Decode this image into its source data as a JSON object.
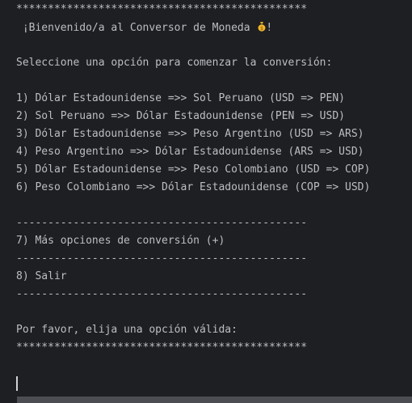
{
  "console": {
    "border_top": "**********************************************",
    "welcome": " ¡Bienvenido/a al Conversor de Moneda ",
    "welcome_icon": "money-bag-icon",
    "welcome_end": "!",
    "prompt_select": "Seleccione una opción para comenzar la conversión:",
    "options": [
      "1) Dólar Estadounidense =>> Sol Peruano (USD => PEN)",
      "2) Sol Peruano =>> Dólar Estadounidense (PEN => USD)",
      "3) Dólar Estadounidense =>> Peso Argentino (USD => ARS)",
      "4) Peso Argentino =>> Dólar Estadounidense (ARS => USD)",
      "5) Dólar Estadounidense =>> Peso Colombiano (USD => COP)",
      "6) Peso Colombiano =>> Dólar Estadounidense (COP => USD)"
    ],
    "separator": "----------------------------------------------",
    "more_options": "7) Más opciones de conversión (+)",
    "exit_option": "8) Salir",
    "prompt_choose": "Por favor, elija una opción válida:",
    "border_bottom": "**********************************************"
  },
  "colors": {
    "background": "#1e1f22",
    "text": "#bcbec4",
    "scrollbar": "#4b4d52"
  }
}
